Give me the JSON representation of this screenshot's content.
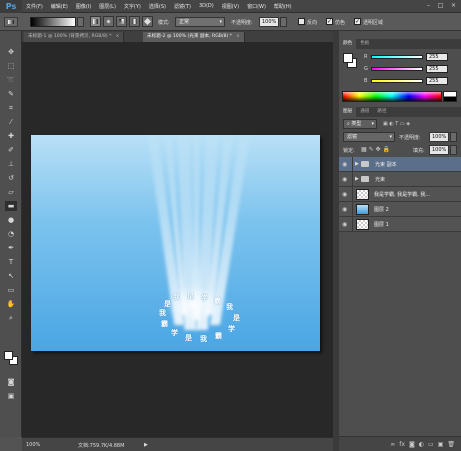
{
  "app": {
    "logo": "Ps"
  },
  "menu": [
    "文件(F)",
    "编辑(E)",
    "图像(I)",
    "图层(L)",
    "文字(Y)",
    "选择(S)",
    "滤镜(T)",
    "3D(D)",
    "视图(V)",
    "窗口(W)",
    "帮助(H)"
  ],
  "window_controls": {
    "minimize": "–",
    "maximize": "□",
    "close": "×"
  },
  "options": {
    "mode_label": "模式:",
    "mode_value": "正常",
    "opacity_label": "不透明度:",
    "opacity_value": "100%",
    "reverse_label": "反向",
    "dither_label": "仿色",
    "transparency_label": "透明区域"
  },
  "tabs": [
    {
      "title": "未标题-1 @ 100% (背景拷贝, RGB/8) *",
      "close": "×"
    },
    {
      "title": "未标题-2 @ 100% (光束 副本, RGB/8) *",
      "close": "×"
    }
  ],
  "status": {
    "zoom": "100%",
    "doc_info": "文档:759.7K/4.88M",
    "arrow": "▶"
  },
  "ring_text": [
    "我",
    "是",
    "学",
    "霸",
    "我",
    "是",
    "学",
    "霸",
    "我",
    "是",
    "学",
    "霸",
    "我",
    "是"
  ],
  "color_panel": {
    "tabs": [
      "颜色",
      "色板"
    ],
    "rows": [
      {
        "label": "R",
        "value": "255"
      },
      {
        "label": "G",
        "value": "255"
      },
      {
        "label": "B",
        "value": "255"
      }
    ]
  },
  "layers_panel": {
    "tabs": [
      "图层",
      "通道",
      "路径"
    ],
    "filter_label": "类型",
    "blend_mode": "滤镜",
    "opacity_label": "不透明度:",
    "opacity_value": "100%",
    "lock_label": "锁定:",
    "fill_label": "填充:",
    "fill_value": "100%",
    "layers": [
      {
        "name": "光束 副本",
        "type": "group",
        "selected": true
      },
      {
        "name": "光束",
        "type": "group",
        "selected": false
      },
      {
        "name": "我是学霸, 我是学霸, 我...",
        "type": "text",
        "selected": false
      },
      {
        "name": "图层 2",
        "type": "gradient",
        "selected": false
      },
      {
        "name": "图层 1",
        "type": "empty",
        "selected": false
      }
    ],
    "bottom_icons": [
      "link-icon",
      "fx-icon",
      "mask-icon",
      "adjustment-icon",
      "folder-icon",
      "new-layer-icon",
      "trash-icon"
    ]
  },
  "colors": {
    "canvas_top": "#b9e0f6",
    "canvas_bottom": "#4aa6e4",
    "selected_layer": "#5c6f8a"
  }
}
